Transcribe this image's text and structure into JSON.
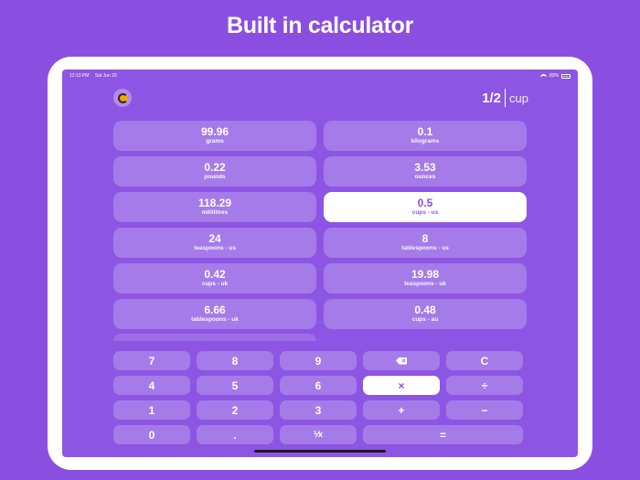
{
  "headline": "Built in calculator",
  "status_bar": {
    "time": "12:13 PM",
    "date": "Sat Jun 20",
    "battery": "83%"
  },
  "amount": {
    "quantity": "1/2",
    "unit": "cup"
  },
  "conversions": [
    {
      "value": "99.96",
      "label": "grams"
    },
    {
      "value": "0.1",
      "label": "kilograms"
    },
    {
      "value": "0.22",
      "label": "pounds"
    },
    {
      "value": "3.53",
      "label": "ounces"
    },
    {
      "value": "118.29",
      "label": "millilitres"
    },
    {
      "value": "0.5",
      "label": "cups - us"
    },
    {
      "value": "24",
      "label": "teaspoons - us"
    },
    {
      "value": "8",
      "label": "tablespoons - us"
    },
    {
      "value": "0.42",
      "label": "cups - uk"
    },
    {
      "value": "19.98",
      "label": "teaspoons - uk"
    },
    {
      "value": "6.66",
      "label": "tablespoons - uk"
    },
    {
      "value": "0.48",
      "label": "cups - au"
    }
  ],
  "keypad": {
    "row1": [
      "7",
      "8",
      "9",
      "backspace",
      "C"
    ],
    "row2": [
      "4",
      "5",
      "6",
      "×",
      "÷"
    ],
    "row3": [
      "1",
      "2",
      "3",
      "+",
      "−"
    ],
    "row4": [
      "0",
      ".",
      "⅟x",
      "="
    ]
  },
  "colors": {
    "background": "#8a4fe0",
    "tile": "#a57be9",
    "active_tile": "#ffffff",
    "accent": "#8a4fe0"
  }
}
